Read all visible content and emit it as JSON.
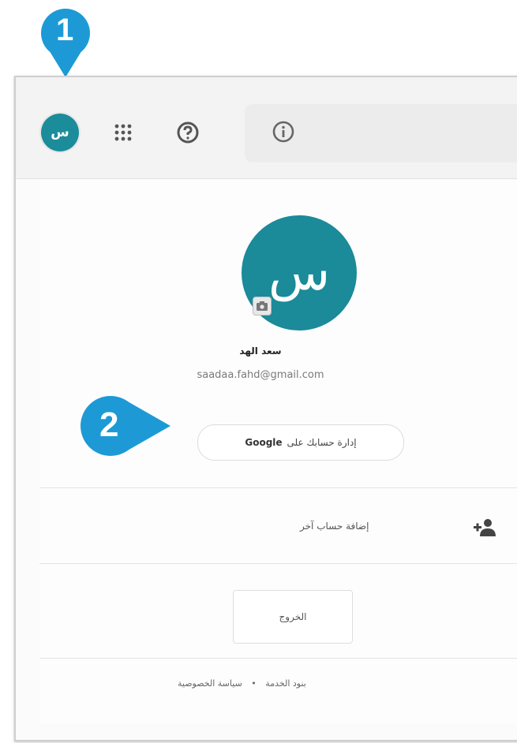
{
  "callouts": [
    "1",
    "2"
  ],
  "toolbar": {
    "avatar_initials": "س",
    "icons": [
      "apps-grid-icon",
      "help-circle-icon",
      "info-icon"
    ]
  },
  "account": {
    "avatar_initials": "س",
    "name": "سعد الهد",
    "email": "saadaa.fahd@gmail.com",
    "manage_prefix": "إدارة حسابك على",
    "manage_brand": "Google",
    "add_account": "إضافة حساب آخر",
    "sign_out": "الخروج",
    "footer_privacy": "سياسة الخصوصية",
    "footer_separator": "•",
    "footer_terms": "بنود الخدمة"
  },
  "colors": {
    "accent": "#1b8c9a",
    "callout": "#1d9ad6"
  }
}
